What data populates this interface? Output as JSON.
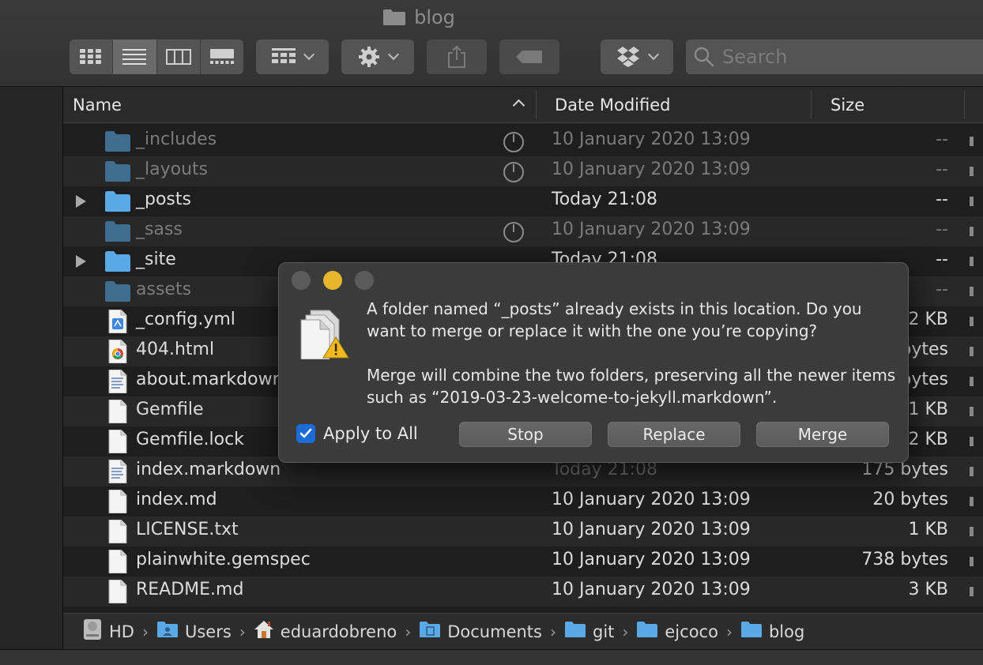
{
  "window": {
    "title": "blog"
  },
  "toolbar": {
    "view_modes": [
      "icon-view",
      "list-view",
      "column-view",
      "gallery-view"
    ],
    "selected_view": "list-view",
    "search_placeholder": "Search"
  },
  "columns": {
    "name": "Name",
    "date": "Date Modified",
    "size": "Size"
  },
  "files": [
    {
      "name": "_includes",
      "date": "10 January 2020 13:09",
      "size": "--",
      "icon": "folder-icon",
      "dim": true,
      "disclosure": false,
      "sync": true
    },
    {
      "name": "_layouts",
      "date": "10 January 2020 13:09",
      "size": "--",
      "icon": "folder-icon",
      "dim": true,
      "disclosure": false,
      "sync": true
    },
    {
      "name": "_posts",
      "date": "Today 21:08",
      "size": "--",
      "icon": "folder-icon",
      "dim": false,
      "disclosure": true,
      "sync": false
    },
    {
      "name": "_sass",
      "date": "10 January 2020 13:09",
      "size": "--",
      "icon": "folder-icon",
      "dim": true,
      "disclosure": false,
      "sync": true
    },
    {
      "name": "_site",
      "date": "Today 21:08",
      "size": "--",
      "icon": "folder-icon",
      "dim": false,
      "disclosure": true,
      "sync": false
    },
    {
      "name": "assets",
      "date": "",
      "size": "--",
      "icon": "folder-icon",
      "dim": true,
      "disclosure": false,
      "sync": false
    },
    {
      "name": "_config.yml",
      "date": "",
      "size": "2 KB",
      "icon": "yml-file-icon",
      "dim": false,
      "disclosure": false,
      "sync": false
    },
    {
      "name": "404.html",
      "date": "",
      "size": "bytes",
      "icon": "chrome-html-icon",
      "dim": false,
      "disclosure": false,
      "sync": false
    },
    {
      "name": "about.markdown",
      "date": "",
      "size": "bytes",
      "icon": "text-file-icon",
      "dim": false,
      "disclosure": false,
      "sync": false
    },
    {
      "name": "Gemfile",
      "date": "",
      "size": "1 KB",
      "icon": "document-icon",
      "dim": false,
      "disclosure": false,
      "sync": false
    },
    {
      "name": "Gemfile.lock",
      "date": "",
      "size": "2 KB",
      "icon": "document-icon",
      "dim": false,
      "disclosure": false,
      "sync": false
    },
    {
      "name": "index.markdown",
      "date": "Today 21:08",
      "size": "175 bytes",
      "icon": "text-file-icon",
      "dim": false,
      "dimDate": true,
      "disclosure": false,
      "sync": false
    },
    {
      "name": "index.md",
      "date": "10 January 2020 13:09",
      "size": "20 bytes",
      "icon": "document-icon",
      "dim": false,
      "disclosure": false,
      "sync": false
    },
    {
      "name": "LICENSE.txt",
      "date": "10 January 2020 13:09",
      "size": "1 KB",
      "icon": "document-icon",
      "dim": false,
      "disclosure": false,
      "sync": false
    },
    {
      "name": "plainwhite.gemspec",
      "date": "10 January 2020 13:09",
      "size": "738 bytes",
      "icon": "document-icon",
      "dim": false,
      "disclosure": false,
      "sync": false
    },
    {
      "name": "README.md",
      "date": "10 January 2020 13:09",
      "size": "3 KB",
      "icon": "document-icon",
      "dim": false,
      "disclosure": false,
      "sync": false
    }
  ],
  "pathbar": [
    {
      "label": "HD",
      "icon": "hard-drive-icon"
    },
    {
      "label": "Users",
      "icon": "users-folder-icon"
    },
    {
      "label": "eduardobreno",
      "icon": "home-icon"
    },
    {
      "label": "Documents",
      "icon": "documents-folder-icon"
    },
    {
      "label": "git",
      "icon": "folder-icon"
    },
    {
      "label": "ejcoco",
      "icon": "folder-icon"
    },
    {
      "label": "blog",
      "icon": "folder-icon"
    }
  ],
  "dialog": {
    "message": "A folder named “_posts” already exists in this location. Do you want to merge or replace it with the one you’re copying?",
    "detail": "Merge will combine the two folders, preserving all the newer items such as “2019-03-23-welcome-to-jekyll.markdown”.",
    "apply_all_label": "Apply to All",
    "apply_all_checked": true,
    "buttons": {
      "stop": "Stop",
      "replace": "Replace",
      "merge": "Merge"
    },
    "traffic_light_colors": [
      "#5b5b5b",
      "#e6b62c",
      "#5b5b5b"
    ]
  },
  "colors": {
    "folder": "#5aa9e6",
    "folder_dim": "#3f6d8f",
    "accent": "#1d6cd6"
  }
}
